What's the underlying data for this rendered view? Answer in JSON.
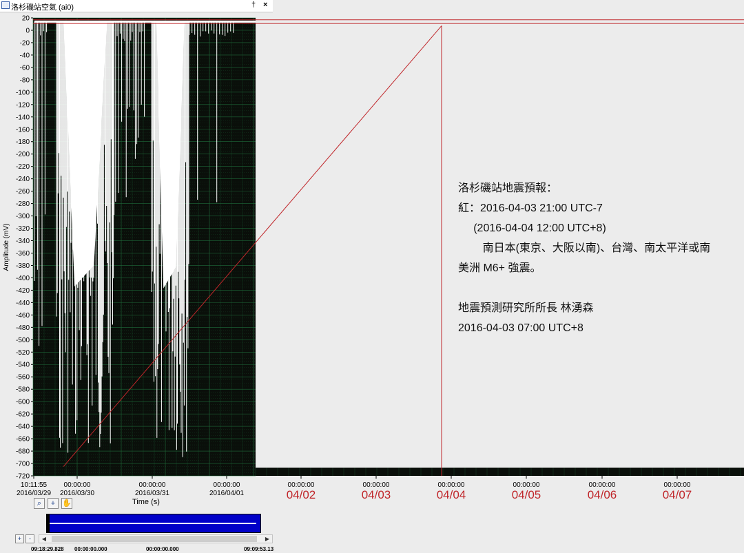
{
  "window": {
    "title": "洛杉磯站空氣 (ai0)",
    "pin_glyph": "†",
    "close_glyph": "×"
  },
  "chart_data": {
    "type": "line",
    "title": "",
    "ylabel": "Amplitude (mV)",
    "xlabel": "Time (s)",
    "ylim": [
      -720,
      20
    ],
    "ytick_step": 20,
    "grid": true,
    "colors": {
      "background": "#0a0f0a",
      "grid": "#1f6b3a",
      "signal": "#ffffff",
      "annotation": "#c0262a"
    },
    "xticks": [
      {
        "time": "10:11:55",
        "date": "2016/03/29"
      },
      {
        "time": "00:00:00",
        "date": "2016/03/30"
      },
      {
        "time": "00:00:00",
        "date": "2016/03/31"
      },
      {
        "time": "00:00:00",
        "date": "2016/04/01"
      }
    ],
    "annot_xticks": [
      {
        "time": "00:00:00",
        "date": "04/02"
      },
      {
        "time": "00:00:00",
        "date": "04/03"
      },
      {
        "time": "00:00:00",
        "date": "04/04"
      },
      {
        "time": "00:00:00",
        "date": "04/05"
      },
      {
        "time": "00:00:00",
        "date": "04/06"
      },
      {
        "time": "00:00:00",
        "date": "04/07"
      }
    ],
    "signal_segments": [
      {
        "x": [
          0.0,
          0.06
        ],
        "baseline": 14,
        "min": -550,
        "note": "spiky"
      },
      {
        "x": [
          0.1,
          0.36
        ],
        "baseline": 14,
        "min": -690,
        "note": "dense"
      },
      {
        "x": [
          0.36,
          0.5
        ],
        "baseline": 14,
        "min": -300,
        "note": "spiky"
      },
      {
        "x": [
          0.53,
          0.7
        ],
        "baseline": 14,
        "min": -695,
        "note": "dense"
      },
      {
        "x": [
          0.7,
          0.9
        ],
        "baseline": 14,
        "min": -400,
        "note": "sparse"
      },
      {
        "x": [
          0.9,
          1.0
        ],
        "baseline": 14,
        "min": 14,
        "note": "flat"
      }
    ],
    "annotation_trend": {
      "from": {
        "date": "2016/03/30",
        "value": -705
      },
      "to": {
        "date": "04/04",
        "value": 14
      },
      "level": 14
    }
  },
  "notice": {
    "lines": [
      "洛杉磯站地震預報：",
      "紅：2016-04-03 21:00 UTC-7",
      "     (2016-04-04 12:00 UTC+8)",
      "        南日本(東京、大阪以南)、台灣、南太平洋或南",
      "美洲 M6+ 強震。",
      "",
      "地震預測研究所所長 林湧森",
      "2016-04-03 07:00 UTC+8"
    ]
  },
  "toolbar": {
    "zoom_icon": "zoom-icon",
    "cursor_icon": "crosshair-icon",
    "pan_icon": "hand-icon",
    "zoom_glyph": "⌕",
    "cursor_glyph": "+",
    "pan_glyph": "✋"
  },
  "overview": {
    "labels": [
      "09:18:29.828",
      "00:00:00.000",
      "00:00:00.000",
      "09:09:53.13"
    ],
    "zoom_in_glyph": "+",
    "zoom_out_glyph": "-",
    "left_arrow": "◀",
    "right_arrow": "▶"
  }
}
